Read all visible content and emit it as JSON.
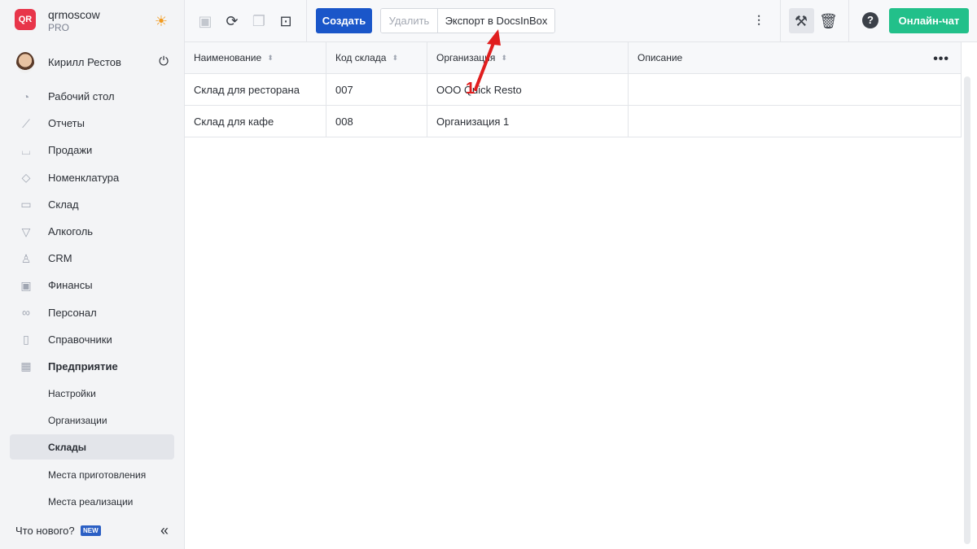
{
  "brand": {
    "logo": "QR",
    "name": "qrmoscow",
    "plan": "PRO"
  },
  "user": {
    "name": "Кирилл Рестов"
  },
  "nav": [
    {
      "label": "Рабочий стол",
      "icon": "dashboard-icon",
      "glyph": "◔"
    },
    {
      "label": "Отчеты",
      "icon": "reports-icon",
      "glyph": "⟋"
    },
    {
      "label": "Продажи",
      "icon": "basket-icon",
      "glyph": "⌴"
    },
    {
      "label": "Номенклатура",
      "icon": "tag-icon",
      "glyph": "◇"
    },
    {
      "label": "Склад",
      "icon": "box-icon",
      "glyph": "▭"
    },
    {
      "label": "Алкоголь",
      "icon": "glass-icon",
      "glyph": "▽"
    },
    {
      "label": "CRM",
      "icon": "crm-icon",
      "glyph": "♙"
    },
    {
      "label": "Финансы",
      "icon": "wallet-icon",
      "glyph": "▣"
    },
    {
      "label": "Персонал",
      "icon": "people-icon",
      "glyph": "∞"
    },
    {
      "label": "Справочники",
      "icon": "book-icon",
      "glyph": "▯"
    },
    {
      "label": "Предприятие",
      "icon": "enterprise-icon",
      "glyph": "▦"
    }
  ],
  "subnav": [
    {
      "label": "Настройки",
      "active": false
    },
    {
      "label": "Организации",
      "active": false
    },
    {
      "label": "Склады",
      "active": true
    },
    {
      "label": "Места приготовления",
      "active": false
    },
    {
      "label": "Места реализации",
      "active": false
    }
  ],
  "whatsnew": {
    "label": "Что нового?",
    "badge": "NEW"
  },
  "toolbar": {
    "create_label": "Создать",
    "delete_label": "Удалить",
    "export_label": "Экспорт в DocsInBox",
    "chat_label": "Онлайн-чат"
  },
  "table": {
    "columns": [
      "Наименование",
      "Код склада",
      "Организация",
      "Описание"
    ],
    "rows": [
      [
        "Склад для ресторана",
        "007",
        "ООО Quick Resto",
        ""
      ],
      [
        "Склад для кафе",
        "008",
        "Организация 1",
        ""
      ]
    ]
  },
  "annotation": {
    "number": "1",
    "color": "#e01e1e"
  },
  "colors": {
    "primary": "#1a56c9",
    "chat": "#22c08a",
    "logo": "#e8354a",
    "theme": "#f29a1e"
  }
}
